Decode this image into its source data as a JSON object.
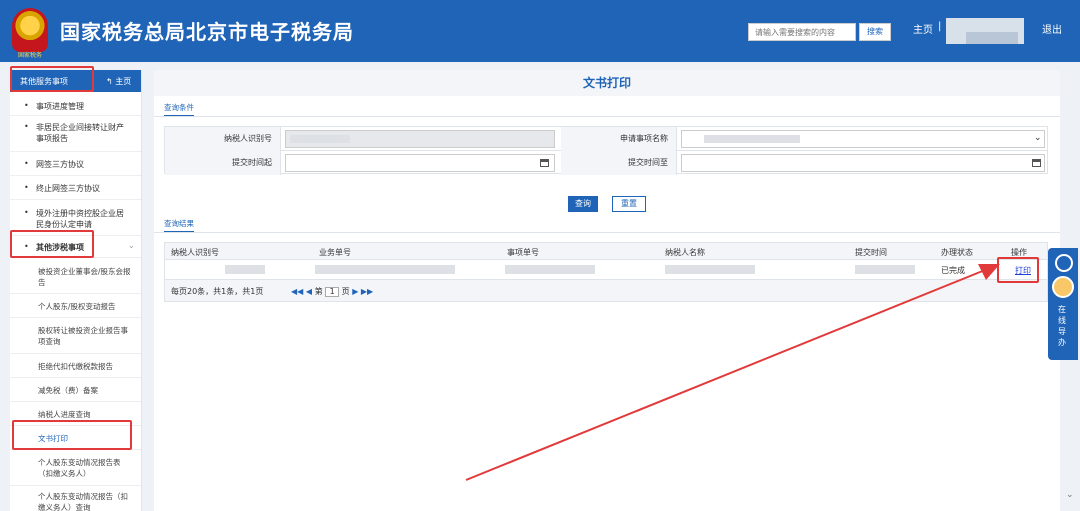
{
  "header": {
    "emblem_caption": "国家税务",
    "title": "国家税务总局北京市电子税务局",
    "search_placeholder": "请输入需要搜索的内容",
    "search_button": "搜索",
    "home": "主页",
    "separator": "|",
    "exit": "退出",
    "brand_color": "#1f64b7"
  },
  "sidebar": {
    "head_label": "其他服务事项",
    "home_label": "主页",
    "items": [
      {
        "label": "事项进度管理"
      },
      {
        "label": "非居民企业间接转让财产事项报告"
      },
      {
        "label": "网签三方协议"
      },
      {
        "label": "终止网签三方协议"
      },
      {
        "label": "境外注册中资控股企业居民身份认定申请"
      },
      {
        "label": "其他涉税事项"
      }
    ],
    "sub_items": [
      {
        "label": "被投资企业董事会/股东会报告"
      },
      {
        "label": "个人股东/股权变动报告"
      },
      {
        "label": "股权转让被投资企业报告事项查询"
      },
      {
        "label": "拒绝代扣代缴税款报告"
      },
      {
        "label": "减免税（费）备案"
      },
      {
        "label": "纳税人进度查询"
      },
      {
        "label": "文书打印"
      },
      {
        "label": "个人股东变动情况报告表（扣缴义务人）"
      },
      {
        "label": "个人股东变动情况报告（扣缴义务人）查询"
      }
    ]
  },
  "main": {
    "title": "文书打印",
    "query_section": "查询条件",
    "result_section": "查询结果",
    "form": {
      "taxpayer_id_label": "纳税人识别号",
      "application_name_label": "申请事项名称",
      "submit_from_label": "提交时间起",
      "submit_to_label": "提交时间至"
    },
    "query_button": "查询",
    "reset_button": "重置",
    "table": {
      "headers": [
        "纳税人识别号",
        "业务单号",
        "事项单号",
        "纳税人名称",
        "提交时间",
        "办理状态",
        "操作"
      ],
      "row": {
        "status": "已完成",
        "action": "打印"
      }
    },
    "pager": {
      "summary": "每页20条，共1条，共1页",
      "first": "◀◀",
      "prev": "◀",
      "page_prefix": "第",
      "page": "1",
      "page_suffix": "页",
      "next": "▶",
      "last": "▶▶"
    }
  },
  "guide": {
    "label": "在线导办"
  },
  "annotation_color": "#e23a3a"
}
